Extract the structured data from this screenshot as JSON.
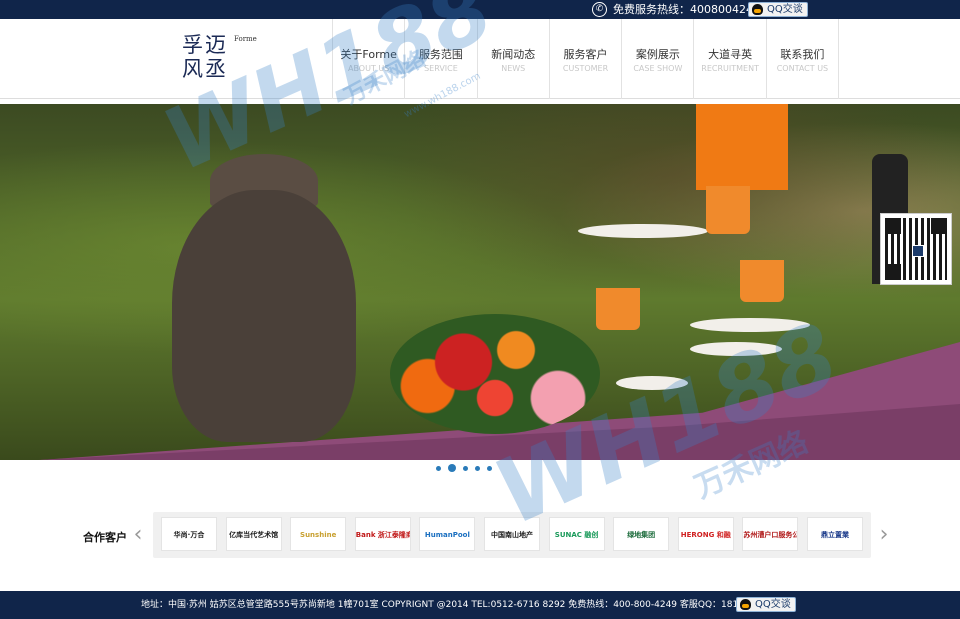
{
  "topbar": {
    "hotline_label": "免费服务热线：4008004249",
    "qq_label": "QQ交谈"
  },
  "logo": {
    "line1": "孚迈",
    "line2": "风丞",
    "sub": "Forme"
  },
  "nav": {
    "items": [
      {
        "cn": "关于Forme",
        "en": "ABOUT US"
      },
      {
        "cn": "服务范围",
        "en": "SERVICE"
      },
      {
        "cn": "新闻动态",
        "en": "NEWS"
      },
      {
        "cn": "服务客户",
        "en": "CUSTOMER"
      },
      {
        "cn": "案例展示",
        "en": "CASE SHOW"
      },
      {
        "cn": "大道寻英",
        "en": "RECRUITMENT"
      },
      {
        "cn": "联系我们",
        "en": "CONTACT US"
      }
    ]
  },
  "banner": {
    "dot_count": 5,
    "active_dot": 2
  },
  "partners": {
    "label": "合作客户",
    "prev_arrow": "‹",
    "next_arrow": "›",
    "items": [
      {
        "name": "华尚·万合",
        "color": "#1a1a1a"
      },
      {
        "name": "亿库当代艺术馆",
        "color": "#1a1a1a"
      },
      {
        "name": "Sunshine",
        "color": "#c8a030"
      },
      {
        "name": "Bank 浙江泰隆商业银行",
        "color": "#c01818"
      },
      {
        "name": "HumanPool",
        "color": "#1a6fc0"
      },
      {
        "name": "中国南山地产",
        "color": "#1a1a1a"
      },
      {
        "name": "SUNAC 融创",
        "color": "#1a9a5a"
      },
      {
        "name": "绿地集团",
        "color": "#1a6a3a"
      },
      {
        "name": "HERONG 和融",
        "color": "#d02020"
      },
      {
        "name": "苏州漕户口服务公司",
        "color": "#b01818"
      },
      {
        "name": "鼎立置業",
        "color": "#1a3a8a"
      }
    ]
  },
  "footer": {
    "info": "地址：中国·苏州 姑苏区总管堂路555号苏尚新地 1幢701室 COPYRIGNT @2014  TEL:0512-6716 8292 免费热线：400-800-4249 客服QQ：1812576861",
    "qq_label": "QQ交谈"
  },
  "watermark": {
    "latin": "WH188",
    "cn": "万禾网络",
    "site": "www.wh188.com"
  },
  "colors": {
    "bar": "#10254a",
    "accent": "#2a7bb9",
    "tablecloth": "#8e4b78"
  },
  "icons": {
    "phone": "phone-icon",
    "qq": "qq-icon",
    "qr": "qr-code-icon"
  }
}
